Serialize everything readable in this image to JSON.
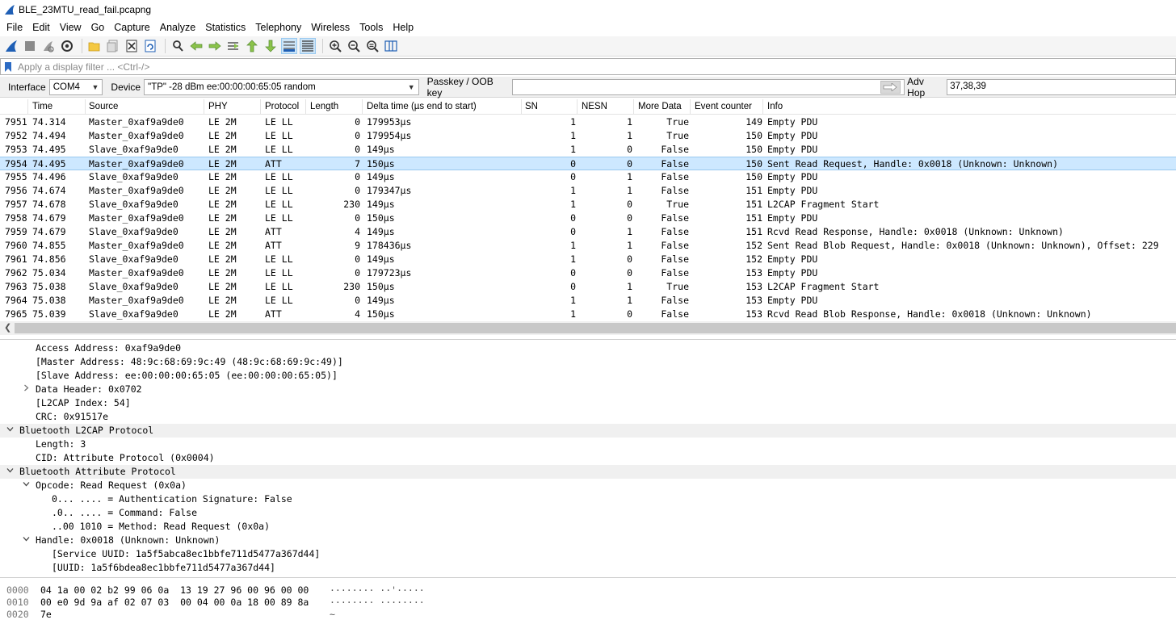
{
  "window": {
    "title": "BLE_23MTU_read_fail.pcapng"
  },
  "menu": [
    "File",
    "Edit",
    "View",
    "Go",
    "Capture",
    "Analyze",
    "Statistics",
    "Telephony",
    "Wireless",
    "Tools",
    "Help"
  ],
  "toolbar": {
    "icons": [
      "shark-fin-start-icon",
      "stop-icon",
      "restart-icon",
      "options-gear-icon",
      "sep",
      "open-folder-icon",
      "file-set-icon",
      "close-file-icon",
      "reload-icon",
      "sep",
      "find-icon",
      "back-arrow-icon",
      "forward-arrow-icon",
      "go-to-packet-icon",
      "first-packet-icon",
      "last-packet-icon",
      "autoscroll-icon",
      "colorize-icon",
      "sep",
      "zoom-in-icon",
      "zoom-out-icon",
      "zoom-normal-icon",
      "resize-columns-icon"
    ]
  },
  "filter": {
    "placeholder": "Apply a display filter ... <Ctrl-/>"
  },
  "interface_bar": {
    "interface_label": "Interface",
    "interface_value": "COM4",
    "device_label": "Device",
    "device_value": "\"TP\"  -28 dBm  ee:00:00:00:65:05  random",
    "passkey_label": "Passkey / OOB key",
    "passkey_value": "",
    "advhop_label": "Adv Hop",
    "advhop_value": "37,38,39"
  },
  "packet_list": {
    "columns": [
      "Time",
      "Source",
      "PHY",
      "Protocol",
      "Length",
      "Delta time (µs end to start)",
      "SN",
      "NESN",
      "More Data",
      "Event counter",
      "Info"
    ],
    "rows": [
      [
        "7951",
        "74.314",
        "Master_0xaf9a9de0",
        "LE 2M",
        "LE LL",
        "0",
        "179953µs",
        "1",
        "1",
        "True",
        "149",
        "Empty PDU"
      ],
      [
        "7952",
        "74.494",
        "Master_0xaf9a9de0",
        "LE 2M",
        "LE LL",
        "0",
        "179954µs",
        "1",
        "1",
        "True",
        "150",
        "Empty PDU"
      ],
      [
        "7953",
        "74.495",
        "Slave_0xaf9a9de0",
        "LE 2M",
        "LE LL",
        "0",
        "149µs",
        "1",
        "0",
        "False",
        "150",
        "Empty PDU"
      ],
      [
        "7954",
        "74.495",
        "Master_0xaf9a9de0",
        "LE 2M",
        "ATT",
        "7",
        "150µs",
        "0",
        "0",
        "False",
        "150",
        "Sent Read Request, Handle: 0x0018 (Unknown: Unknown)"
      ],
      [
        "7955",
        "74.496",
        "Slave_0xaf9a9de0",
        "LE 2M",
        "LE LL",
        "0",
        "149µs",
        "0",
        "1",
        "False",
        "150",
        "Empty PDU"
      ],
      [
        "7956",
        "74.674",
        "Master_0xaf9a9de0",
        "LE 2M",
        "LE LL",
        "0",
        "179347µs",
        "1",
        "1",
        "False",
        "151",
        "Empty PDU"
      ],
      [
        "7957",
        "74.678",
        "Slave_0xaf9a9de0",
        "LE 2M",
        "LE LL",
        "230",
        "149µs",
        "1",
        "0",
        "True",
        "151",
        "L2CAP Fragment Start"
      ],
      [
        "7958",
        "74.679",
        "Master_0xaf9a9de0",
        "LE 2M",
        "LE LL",
        "0",
        "150µs",
        "0",
        "0",
        "False",
        "151",
        "Empty PDU"
      ],
      [
        "7959",
        "74.679",
        "Slave_0xaf9a9de0",
        "LE 2M",
        "ATT",
        "4",
        "149µs",
        "0",
        "1",
        "False",
        "151",
        "Rcvd Read Response, Handle: 0x0018 (Unknown: Unknown)"
      ],
      [
        "7960",
        "74.855",
        "Master_0xaf9a9de0",
        "LE 2M",
        "ATT",
        "9",
        "178436µs",
        "1",
        "1",
        "False",
        "152",
        "Sent Read Blob Request, Handle: 0x0018 (Unknown: Unknown), Offset: 229"
      ],
      [
        "7961",
        "74.856",
        "Slave_0xaf9a9de0",
        "LE 2M",
        "LE LL",
        "0",
        "149µs",
        "1",
        "0",
        "False",
        "152",
        "Empty PDU"
      ],
      [
        "7962",
        "75.034",
        "Master_0xaf9a9de0",
        "LE 2M",
        "LE LL",
        "0",
        "179723µs",
        "0",
        "0",
        "False",
        "153",
        "Empty PDU"
      ],
      [
        "7963",
        "75.038",
        "Slave_0xaf9a9de0",
        "LE 2M",
        "LE LL",
        "230",
        "150µs",
        "0",
        "1",
        "True",
        "153",
        "L2CAP Fragment Start"
      ],
      [
        "7964",
        "75.038",
        "Master_0xaf9a9de0",
        "LE 2M",
        "LE LL",
        "0",
        "149µs",
        "1",
        "1",
        "False",
        "153",
        "Empty PDU"
      ],
      [
        "7965",
        "75.039",
        "Slave_0xaf9a9de0",
        "LE 2M",
        "ATT",
        "4",
        "150µs",
        "1",
        "0",
        "False",
        "153",
        "Rcvd Read Blob Response, Handle: 0x0018 (Unknown: Unknown)"
      ]
    ],
    "selected_index": 3
  },
  "details": [
    {
      "indent": 0,
      "twisty": "",
      "text": "Access Address: 0xaf9a9de0",
      "band": false
    },
    {
      "indent": 0,
      "twisty": "",
      "text": "[Master Address: 48:9c:68:69:9c:49 (48:9c:68:69:9c:49)]",
      "band": false
    },
    {
      "indent": 0,
      "twisty": "",
      "text": "[Slave Address: ee:00:00:00:65:05 (ee:00:00:00:65:05)]",
      "band": false
    },
    {
      "indent": 0,
      "twisty": ">",
      "text": "Data Header: 0x0702",
      "band": false
    },
    {
      "indent": 0,
      "twisty": "",
      "text": "[L2CAP Index: 54]",
      "band": false
    },
    {
      "indent": 0,
      "twisty": "",
      "text": "CRC: 0x91517e",
      "band": false
    },
    {
      "indent": -1,
      "twisty": "v",
      "text": "Bluetooth L2CAP Protocol",
      "band": true
    },
    {
      "indent": 0,
      "twisty": "",
      "text": "Length: 3",
      "band": false
    },
    {
      "indent": 0,
      "twisty": "",
      "text": "CID: Attribute Protocol (0x0004)",
      "band": false
    },
    {
      "indent": -1,
      "twisty": "v",
      "text": "Bluetooth Attribute Protocol",
      "band": true
    },
    {
      "indent": 0,
      "twisty": "v",
      "text": "Opcode: Read Request (0x0a)",
      "band": false
    },
    {
      "indent": 1,
      "twisty": "",
      "text": "0... .... = Authentication Signature: False",
      "band": false
    },
    {
      "indent": 1,
      "twisty": "",
      "text": ".0.. .... = Command: False",
      "band": false
    },
    {
      "indent": 1,
      "twisty": "",
      "text": "..00 1010 = Method: Read Request (0x0a)",
      "band": false
    },
    {
      "indent": 0,
      "twisty": "v",
      "text": "Handle: 0x0018 (Unknown: Unknown)",
      "band": false
    },
    {
      "indent": 1,
      "twisty": "",
      "text": "[Service UUID: 1a5f5abca8ec1bbfe711d5477a367d44]",
      "band": false
    },
    {
      "indent": 1,
      "twisty": "",
      "text": "[UUID: 1a5f6bdea8ec1bbfe711d5477a367d44]",
      "band": false
    }
  ],
  "hex": [
    {
      "offset": "0000",
      "bytes": "04 1a 00 02 b2 99 06 0a  13 19 27 96 00 96 00 00",
      "ascii": "········ ··'·····"
    },
    {
      "offset": "0010",
      "bytes": "00 e0 9d 9a af 02 07 03  00 04 00 0a 18 00 89 8a",
      "ascii": "········ ········"
    },
    {
      "offset": "0020",
      "bytes": "7e",
      "ascii": "~"
    }
  ],
  "colors": {
    "selection": "#cde8ff",
    "band": "#f0f0f0",
    "accent": "#1e64c8"
  }
}
